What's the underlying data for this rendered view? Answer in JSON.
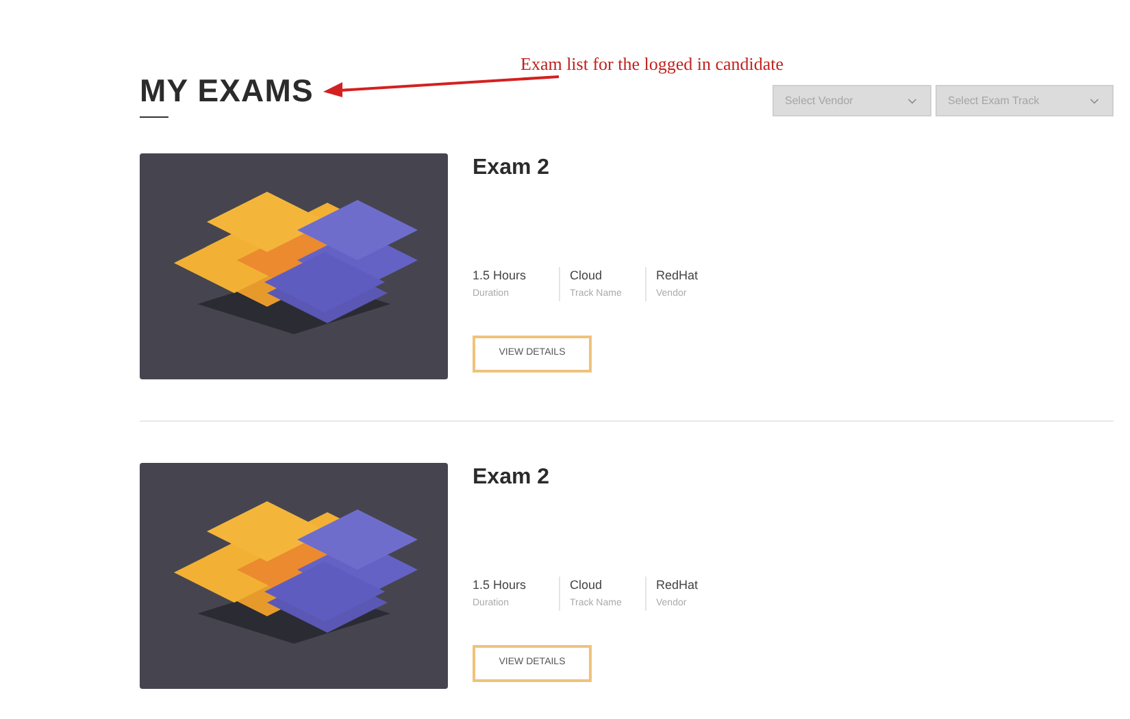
{
  "annotation": {
    "text": "Exam list for the logged in candidate"
  },
  "heading": "MY EXAMS",
  "filters": [
    {
      "placeholder": "Select Vendor"
    },
    {
      "placeholder": "Select Exam Track"
    }
  ],
  "exams": [
    {
      "title": "Exam 2",
      "stats": [
        {
          "value": "1.5 Hours",
          "label": "Duration"
        },
        {
          "value": "Cloud",
          "label": "Track Name"
        },
        {
          "value": "RedHat",
          "label": "Vendor"
        }
      ],
      "button": "VIEW DETAILS"
    },
    {
      "title": "Exam 2",
      "stats": [
        {
          "value": "1.5 Hours",
          "label": "Duration"
        },
        {
          "value": "Cloud",
          "label": "Track Name"
        },
        {
          "value": "RedHat",
          "label": "Vendor"
        }
      ],
      "button": "VIEW DETAILS"
    }
  ]
}
